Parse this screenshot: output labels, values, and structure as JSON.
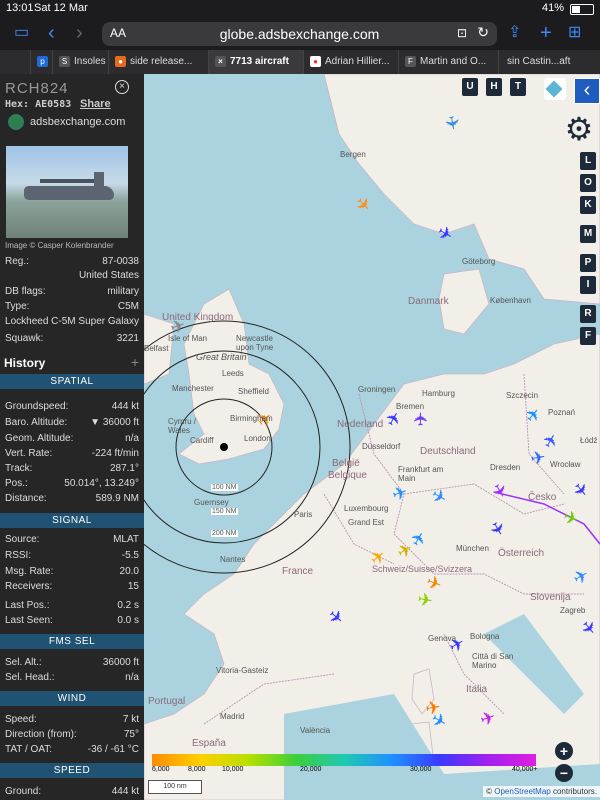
{
  "status_bar": {
    "time": "13:01",
    "date": "Sat 12 Mar",
    "battery": "41%"
  },
  "browser": {
    "address_aa": "AA",
    "host": "globe.adsbexchange.com",
    "tabs": [
      {
        "label": "Insoles F"
      },
      {
        "label": "side release..."
      },
      {
        "label": "7713 aircraft",
        "active": true
      },
      {
        "label": "Adrian Hillier..."
      },
      {
        "label": "Martin and O..."
      },
      {
        "label": "sin Castin...aft"
      }
    ]
  },
  "aircraft": {
    "callsign": "RCH824",
    "hex_label": "Hex:",
    "hex": "AE0583",
    "share": "Share",
    "source_link": "adsbexchange.com",
    "image_credit": "Image © Casper Kolenbrander",
    "reg_label": "Reg.:",
    "reg": "87-0038",
    "country": "United States",
    "db_flags_label": "DB flags:",
    "db_flags": "military",
    "type_label": "Type:",
    "type": "C5M",
    "type_full": "Lockheed C-5M Super Galaxy",
    "squawk_label": "Squawk:",
    "squawk": "3221"
  },
  "history": {
    "title": "History",
    "add": "+"
  },
  "spatial": {
    "title": "SPATIAL",
    "groundspeed_label": "Groundspeed:",
    "groundspeed": "444 kt",
    "baro_label": "Baro. Altitude:",
    "baro": "▼ 36000 ft",
    "geom_label": "Geom. Altitude:",
    "geom": "n/a",
    "vert_label": "Vert. Rate:",
    "vert": "-224 ft/min",
    "track_label": "Track:",
    "track": "287.1°",
    "pos_label": "Pos.:",
    "pos": "50.014°, 13.249°",
    "dist_label": "Distance:",
    "dist": "589.9 NM"
  },
  "signal": {
    "title": "SIGNAL",
    "source_label": "Source:",
    "source": "MLAT",
    "rssi_label": "RSSI:",
    "rssi": "-5.5",
    "msgrate_label": "Msg. Rate:",
    "msgrate": "20.0",
    "receivers_label": "Receivers:",
    "receivers": "15",
    "lastpos_label": "Last Pos.:",
    "lastpos": "0.2 s",
    "lastseen_label": "Last Seen:",
    "lastseen": "0.0 s"
  },
  "fms": {
    "title": "FMS SEL",
    "selalt_label": "Sel. Alt.:",
    "selalt": "36000 ft",
    "selhead_label": "Sel. Head.:",
    "selhead": "n/a"
  },
  "wind": {
    "title": "WIND",
    "speed_label": "Speed:",
    "speed": "7 kt",
    "dir_label": "Direction (from):",
    "dir": "75°",
    "tat_label": "TAT / OAT:",
    "tat": "-36 / -61 °C"
  },
  "speed": {
    "title": "SPEED",
    "ground_label": "Ground:",
    "ground": "444 kt"
  },
  "map": {
    "toggles_top": [
      "U",
      "H",
      "T"
    ],
    "toggles_side": [
      "L",
      "O",
      "K",
      "M",
      "P",
      "I",
      "R",
      "F"
    ],
    "range_labels": [
      "100 NM",
      "150 NM",
      "200 NM"
    ],
    "legend": [
      "6,000",
      "8,000",
      "10,000",
      "20,000",
      "30,000",
      "40,000+"
    ],
    "scale": "100 nm",
    "attribution_prefix": "©",
    "attribution_link": "OpenStreetMap",
    "attribution_suffix": "contributors.",
    "places": {
      "bergen": "Bergen",
      "goteborg": "Göteborg",
      "danmark": "Danmark",
      "kobenhavn": "København",
      "uk": "United Kingdom",
      "newcastle": "Newcastle upon Tyne",
      "isle": "Isle of Man",
      "belfast": "Belfast",
      "greatbritain": "Great Britain",
      "leeds": "Leeds",
      "manchester": "Manchester",
      "sheffield": "Sheffield",
      "birmingham": "Birmingham",
      "wales": "Cymru / Wales",
      "cardiff": "Cardiff",
      "london": "London",
      "guernsey": "Guernsey",
      "paris": "Paris",
      "nantes": "Nantes",
      "france": "France",
      "nederland": "Nederland",
      "groningen": "Groningen",
      "hamburg": "Hamburg",
      "bremen": "Bremen",
      "szczecin": "Szczecin",
      "poznan": "Poznań",
      "deutschland": "Deutschland",
      "dusseldorf": "Düsseldorf",
      "belgie": "België",
      "belgique": "Belgique",
      "luxembourg": "Luxembourg",
      "frankfurt": "Frankfurt am Main",
      "dresden": "Dresden",
      "wroclaw": "Wrocław",
      "cesko": "Česko",
      "grandest": "Grand Est",
      "munchen": "München",
      "osterreich": "Österreich",
      "schweiz": "Schweiz/Suisse/Svizzera",
      "slovenija": "Slovenija",
      "genova": "Genova",
      "bologna": "Bologna",
      "sanmarino": "Città di San Marino",
      "italia": "Italia",
      "espana": "España",
      "vitoria": "Vitoria-Gasteiz",
      "portugal": "Portugal",
      "madrid": "Madrid",
      "valencia": "València",
      "lodz": "Łódź",
      "zagreb": "Zagreb"
    }
  }
}
